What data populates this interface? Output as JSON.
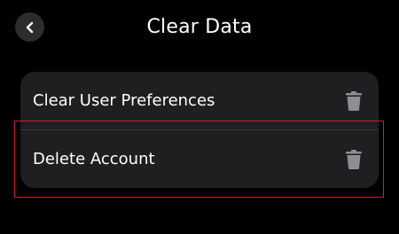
{
  "header": {
    "title": "Clear Data",
    "back_icon": "chevron-left-icon"
  },
  "options": [
    {
      "label": "Clear User Preferences",
      "icon": "trash-icon"
    },
    {
      "label": "Delete Account",
      "icon": "trash-icon"
    }
  ],
  "colors": {
    "background": "#000000",
    "card": "#1f1f21",
    "divider": "#3a3a3c",
    "icon": "#8e8e93",
    "highlight": "#d0202a"
  }
}
